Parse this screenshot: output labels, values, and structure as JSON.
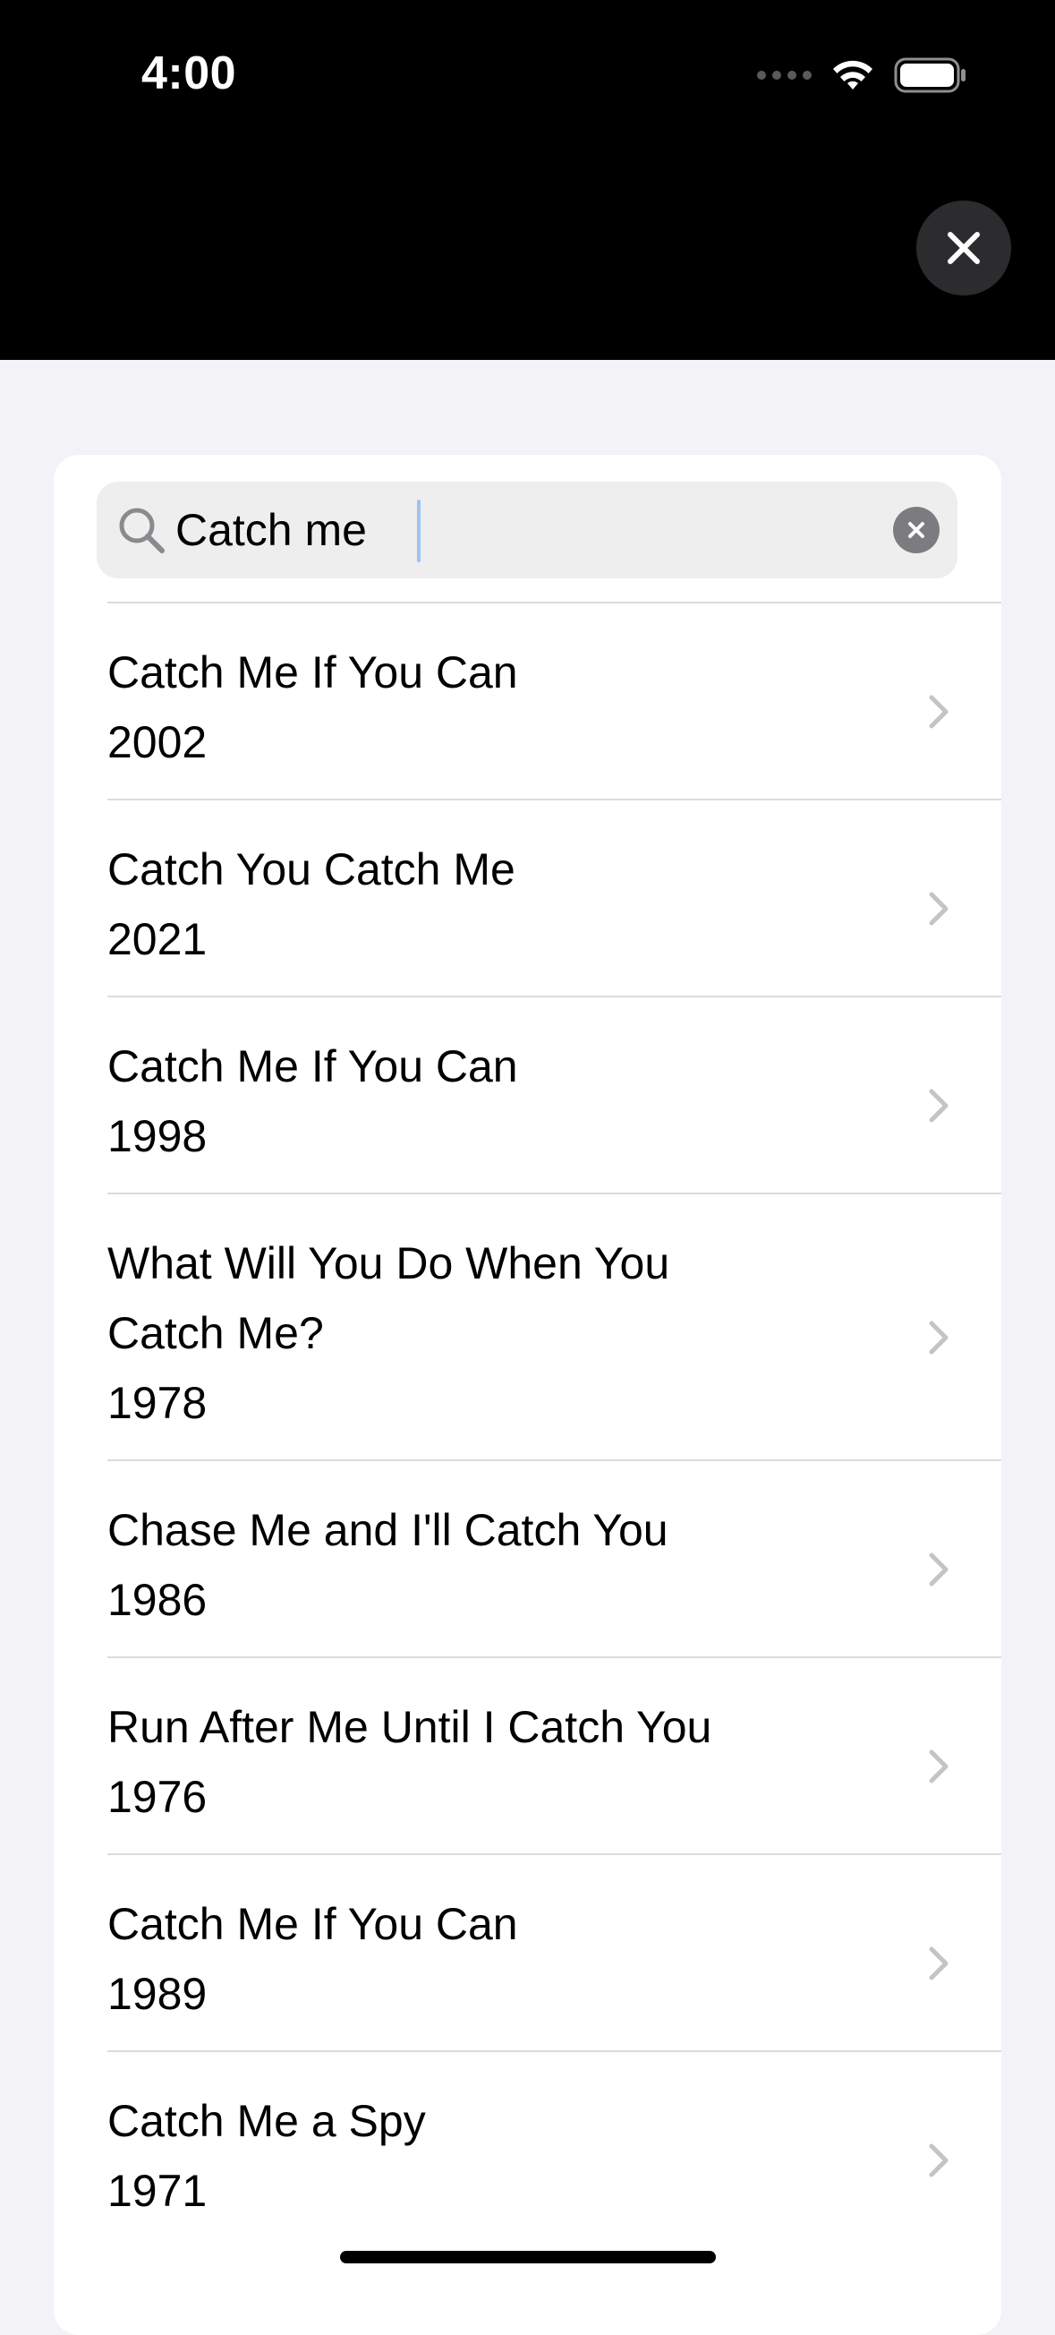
{
  "status_bar": {
    "time": "4:00"
  },
  "search": {
    "query": "Catch me"
  },
  "results": [
    {
      "title": "Catch Me If You Can",
      "year": "2002"
    },
    {
      "title": "Catch You Catch Me",
      "year": "2021"
    },
    {
      "title": "Catch Me If You Can",
      "year": "1998"
    },
    {
      "title": "What Will You Do When You Catch Me?",
      "year": "1978"
    },
    {
      "title": "Chase Me and I'll Catch You",
      "year": "1986"
    },
    {
      "title": "Run After Me Until I Catch You",
      "year": "1976"
    },
    {
      "title": "Catch Me If You Can",
      "year": "1989"
    },
    {
      "title": "Catch Me a Spy",
      "year": "1971"
    }
  ],
  "colors": {
    "background": "#f2f2f7",
    "header": "#000000",
    "close_button": "#2c2c2e",
    "caret": "#9cc4f0",
    "chevron": "#c4c4c7"
  },
  "icons": [
    "signal-icon",
    "wifi-icon",
    "battery-icon",
    "close-icon",
    "search-icon",
    "clear-icon",
    "chevron-right-icon"
  ]
}
